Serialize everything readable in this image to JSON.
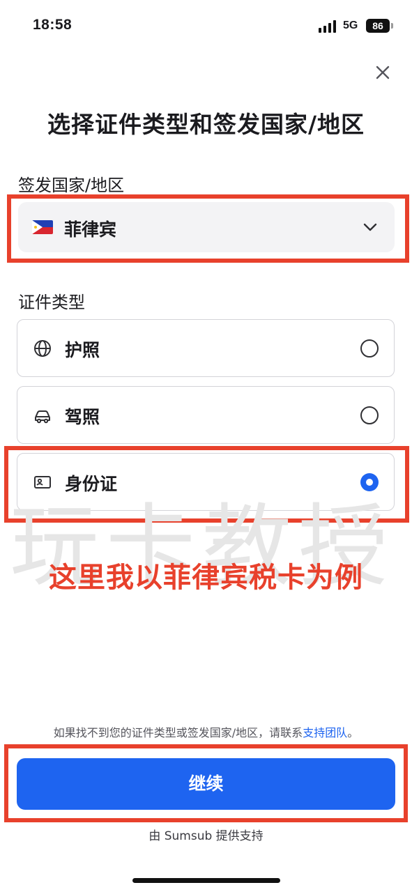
{
  "status_bar": {
    "time": "18:58",
    "network": "5G",
    "battery": "86"
  },
  "title": "选择证件类型和签发国家/地区",
  "country_section": {
    "label": "签发国家/地区",
    "selected": "菲律宾",
    "flag_icon": "philippines-flag-icon",
    "dropdown_icon": "chevron-down-icon"
  },
  "document_section": {
    "label": "证件类型",
    "options": [
      {
        "label": "护照",
        "icon": "globe-icon",
        "selected": false
      },
      {
        "label": "驾照",
        "icon": "car-icon",
        "selected": false
      },
      {
        "label": "身份证",
        "icon": "id-card-icon",
        "selected": true
      }
    ]
  },
  "watermark": "玩卡教授",
  "annotation": "这里我以菲律宾税卡为例",
  "help": {
    "text": "如果找不到您的证件类型或签发国家/地区，请联系",
    "link": "支持团队",
    "suffix": "。"
  },
  "continue_button": "继续",
  "footer": "由 Sumsub 提供支持",
  "colors": {
    "primary": "#1e64f0",
    "annotation_red": "#e8412c"
  }
}
